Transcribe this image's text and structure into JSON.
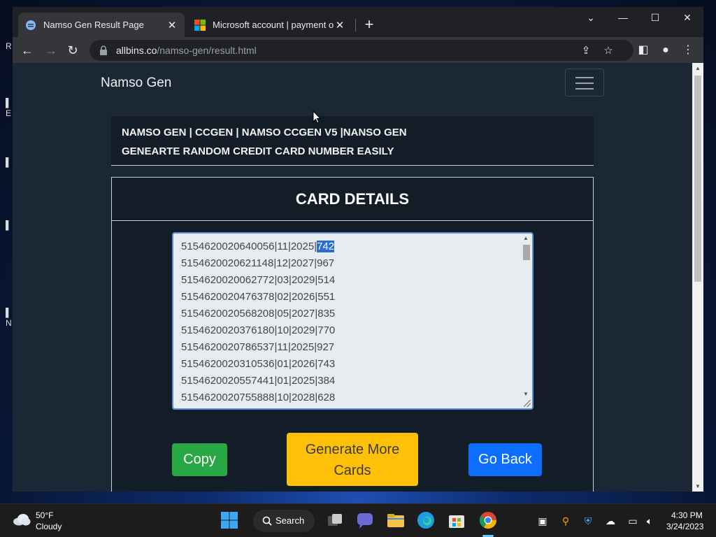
{
  "browser": {
    "tabs": [
      {
        "title": "Namso Gen Result Page",
        "active": true
      },
      {
        "title": "Microsoft account | payment opt",
        "active": false
      }
    ],
    "url_host": "allbins.co",
    "url_path": "/namso-gen/result.html"
  },
  "page": {
    "brand": "Namso Gen",
    "info_line1": "NAMSO GEN | CCGEN | NAMSO CCGEN V5 |NANSO GEN",
    "info_line2": "GENEARTE RANDOM CREDIT CARD NUMBER EASILY",
    "card_header": "CARD DETAILS",
    "cards": [
      {
        "prefix": "5154620020640056|11|2025|",
        "cvv": "742",
        "selected": true
      },
      {
        "prefix": "5154620020621148|12|2027|",
        "cvv": "967"
      },
      {
        "prefix": "5154620020062772|03|2029|",
        "cvv": "514"
      },
      {
        "prefix": "5154620020476378|02|2026|",
        "cvv": "551"
      },
      {
        "prefix": "5154620020568208|05|2027|",
        "cvv": "835"
      },
      {
        "prefix": "5154620020376180|10|2029|",
        "cvv": "770"
      },
      {
        "prefix": "5154620020786537|11|2025|",
        "cvv": "927"
      },
      {
        "prefix": "5154620020310536|01|2026|",
        "cvv": "743"
      },
      {
        "prefix": "5154620020557441|01|2025|",
        "cvv": "384"
      },
      {
        "prefix": "5154620020755888|10|2028|",
        "cvv": "628"
      }
    ],
    "copy_label": "Copy",
    "generate_label_1": "Generate More",
    "generate_label_2": "Cards",
    "back_label": "Go Back"
  },
  "taskbar": {
    "weather_temp": "50°F",
    "weather_cond": "Cloudy",
    "search_label": "Search",
    "time": "4:30 PM",
    "date": "3/24/2023"
  },
  "colors": {
    "copy": "#28a745",
    "generate": "#ffc107",
    "back": "#0d6efd",
    "page_bg": "#1b2735"
  }
}
